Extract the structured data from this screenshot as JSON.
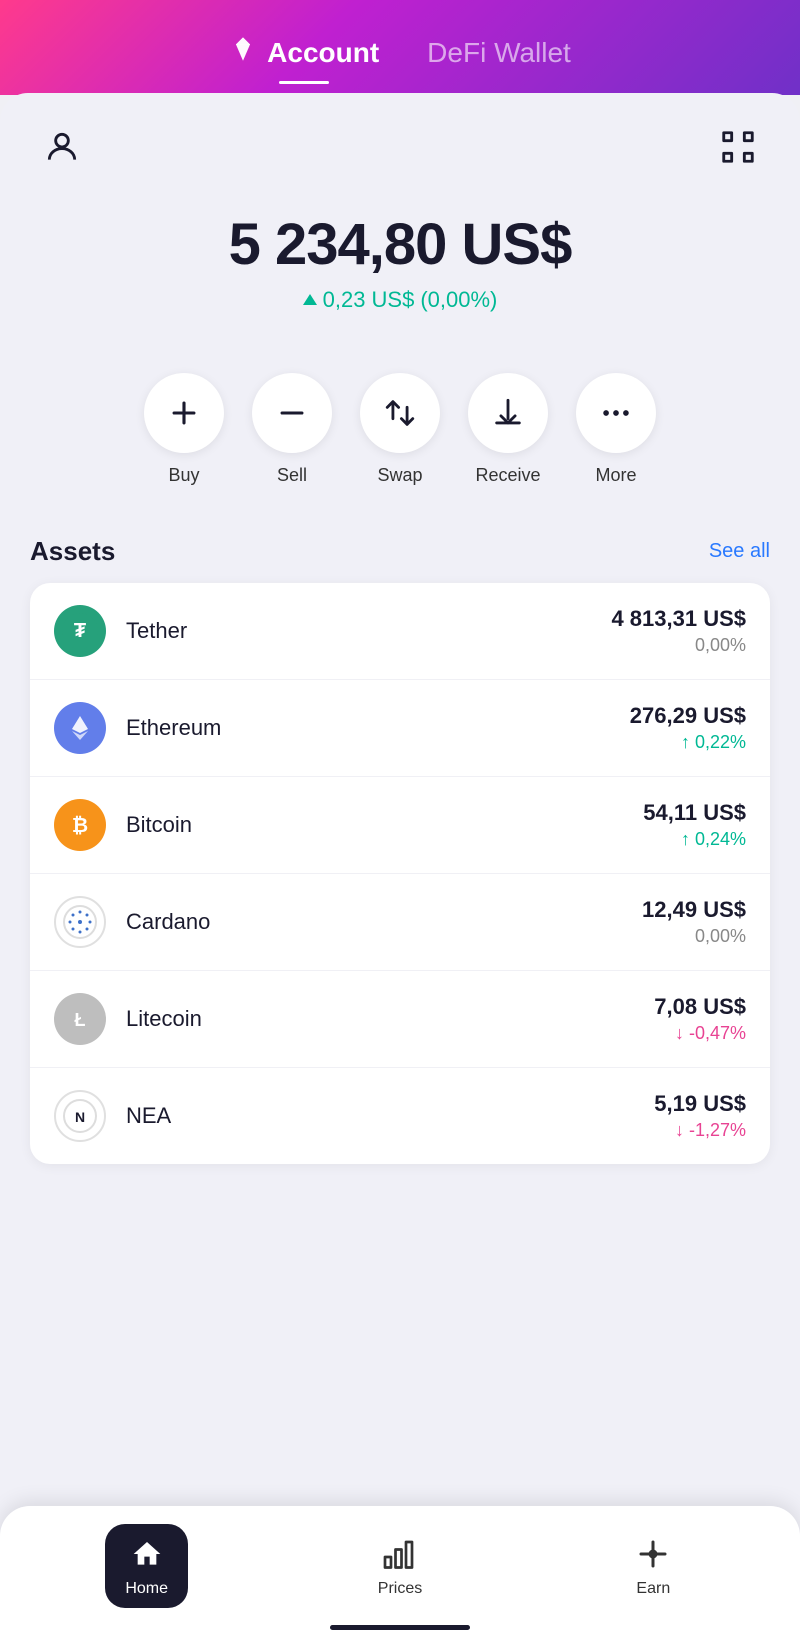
{
  "header": {
    "account_label": "Account",
    "defi_label": "DeFi Wallet"
  },
  "balance": {
    "amount": "5 234,80 US$",
    "change_amount": "0,23 US$",
    "change_pct": "(0,00%)"
  },
  "actions": [
    {
      "id": "buy",
      "label": "Buy",
      "icon": "plus"
    },
    {
      "id": "sell",
      "label": "Sell",
      "icon": "minus"
    },
    {
      "id": "swap",
      "label": "Swap",
      "icon": "swap"
    },
    {
      "id": "receive",
      "label": "Receive",
      "icon": "download"
    },
    {
      "id": "more",
      "label": "More",
      "icon": "dots"
    }
  ],
  "assets_section": {
    "title": "Assets",
    "see_all": "See all"
  },
  "assets": [
    {
      "name": "Tether",
      "usd": "4 813,31 US$",
      "pct": "0,00%",
      "pct_type": "neutral",
      "logo_type": "tether"
    },
    {
      "name": "Ethereum",
      "usd": "276,29 US$",
      "pct": "↑ 0,22%",
      "pct_type": "up",
      "logo_type": "eth"
    },
    {
      "name": "Bitcoin",
      "usd": "54,11 US$",
      "pct": "↑ 0,24%",
      "pct_type": "up",
      "logo_type": "btc"
    },
    {
      "name": "Cardano",
      "usd": "12,49 US$",
      "pct": "0,00%",
      "pct_type": "neutral",
      "logo_type": "ada"
    },
    {
      "name": "Litecoin",
      "usd": "7,08 US$",
      "pct": "↓ -0,47%",
      "pct_type": "down",
      "logo_type": "ltc"
    },
    {
      "name": "NEA",
      "usd": "5,19 US$",
      "pct": "↓ -1,27%",
      "pct_type": "down",
      "logo_type": "nea"
    }
  ],
  "nav": {
    "home": "Home",
    "prices": "Prices",
    "earn": "Earn"
  }
}
